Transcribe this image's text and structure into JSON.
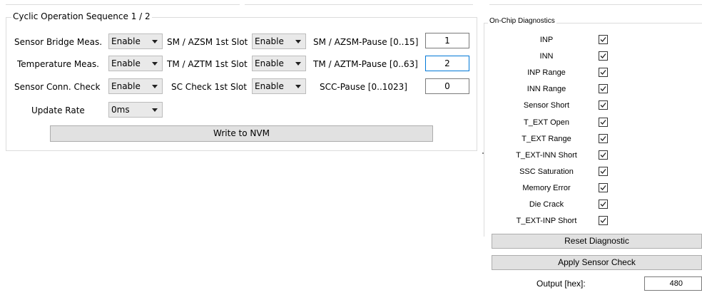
{
  "cyclic": {
    "title": "Cyclic Operation Sequence 1 / 2",
    "rows": [
      {
        "label": "Sensor Bridge Meas.",
        "select_value": "Enable",
        "slot_label": "SM / AZSM 1st Slot",
        "slot_value": "Enable",
        "pause_label": "SM / AZSM-Pause [0..15]",
        "pause_value": "1"
      },
      {
        "label": "Temperature Meas.",
        "select_value": "Enable",
        "slot_label": "TM / AZTM 1st Slot",
        "slot_value": "Enable",
        "pause_label": "TM / AZTM-Pause [0..63]",
        "pause_value": "2"
      },
      {
        "label": "Sensor Conn. Check",
        "select_value": "Enable",
        "slot_label": "SC Check 1st Slot",
        "slot_value": "Enable",
        "pause_label": "SCC-Pause [0..1023]",
        "pause_value": "0"
      }
    ],
    "update_rate": {
      "label": "Update Rate",
      "value": "0ms"
    },
    "write_button": "Write to NVM"
  },
  "diagnostics": {
    "title": "On-Chip Diagnostics",
    "items": [
      {
        "label": "INP",
        "checked": true
      },
      {
        "label": "INN",
        "checked": true
      },
      {
        "label": "INP Range",
        "checked": true
      },
      {
        "label": "INN Range",
        "checked": true
      },
      {
        "label": "Sensor Short",
        "checked": true
      },
      {
        "label": "T_EXT Open",
        "checked": true
      },
      {
        "label": "T_EXT Range",
        "checked": true
      },
      {
        "label": "T_EXT-INN Short",
        "checked": true
      },
      {
        "label": "SSC Saturation",
        "checked": true
      },
      {
        "label": "Memory Error",
        "checked": true
      },
      {
        "label": "Die Crack",
        "checked": true
      },
      {
        "label": "T_EXT-INP Short",
        "checked": true
      }
    ],
    "reset_button": "Reset Diagnostic",
    "apply_button": "Apply Sensor Check",
    "output_label": "Output [hex]:",
    "output_value": "480"
  }
}
